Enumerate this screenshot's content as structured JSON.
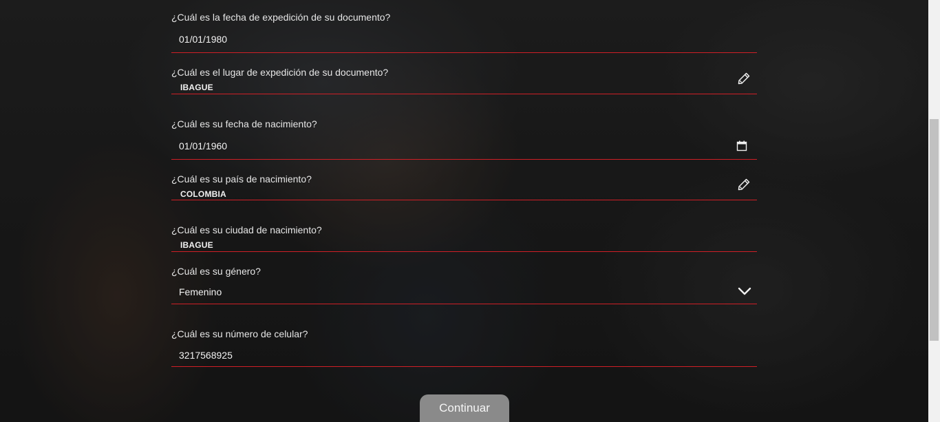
{
  "form": {
    "fields": [
      {
        "label": "¿Cuál es la fecha de expedición de su documento?",
        "value": "01/01/1980",
        "icon": ""
      },
      {
        "label": "¿Cuál es el lugar de expedición de su documento?",
        "value": "IBAGUE",
        "icon": "pencil-icon"
      },
      {
        "label": "¿Cuál es su fecha de nacimiento?",
        "value": "01/01/1960",
        "icon": "calendar-icon"
      },
      {
        "label": "¿Cuál es su país de nacimiento?",
        "value": "COLOMBIA",
        "icon": "pencil-icon"
      },
      {
        "label": "¿Cuál es su ciudad de nacimiento?",
        "value": "IBAGUE",
        "icon": ""
      },
      {
        "label": "¿Cuál es su género?",
        "value": "Femenino",
        "icon": "chevron-down-icon"
      },
      {
        "label": "¿Cuál es su número de celular?",
        "value": "3217568925",
        "icon": ""
      }
    ],
    "continue_label": "Continuar"
  },
  "colors": {
    "underline": "#d11f26",
    "button_bg": "#8a8a8a",
    "text": "#e6e6e6"
  }
}
